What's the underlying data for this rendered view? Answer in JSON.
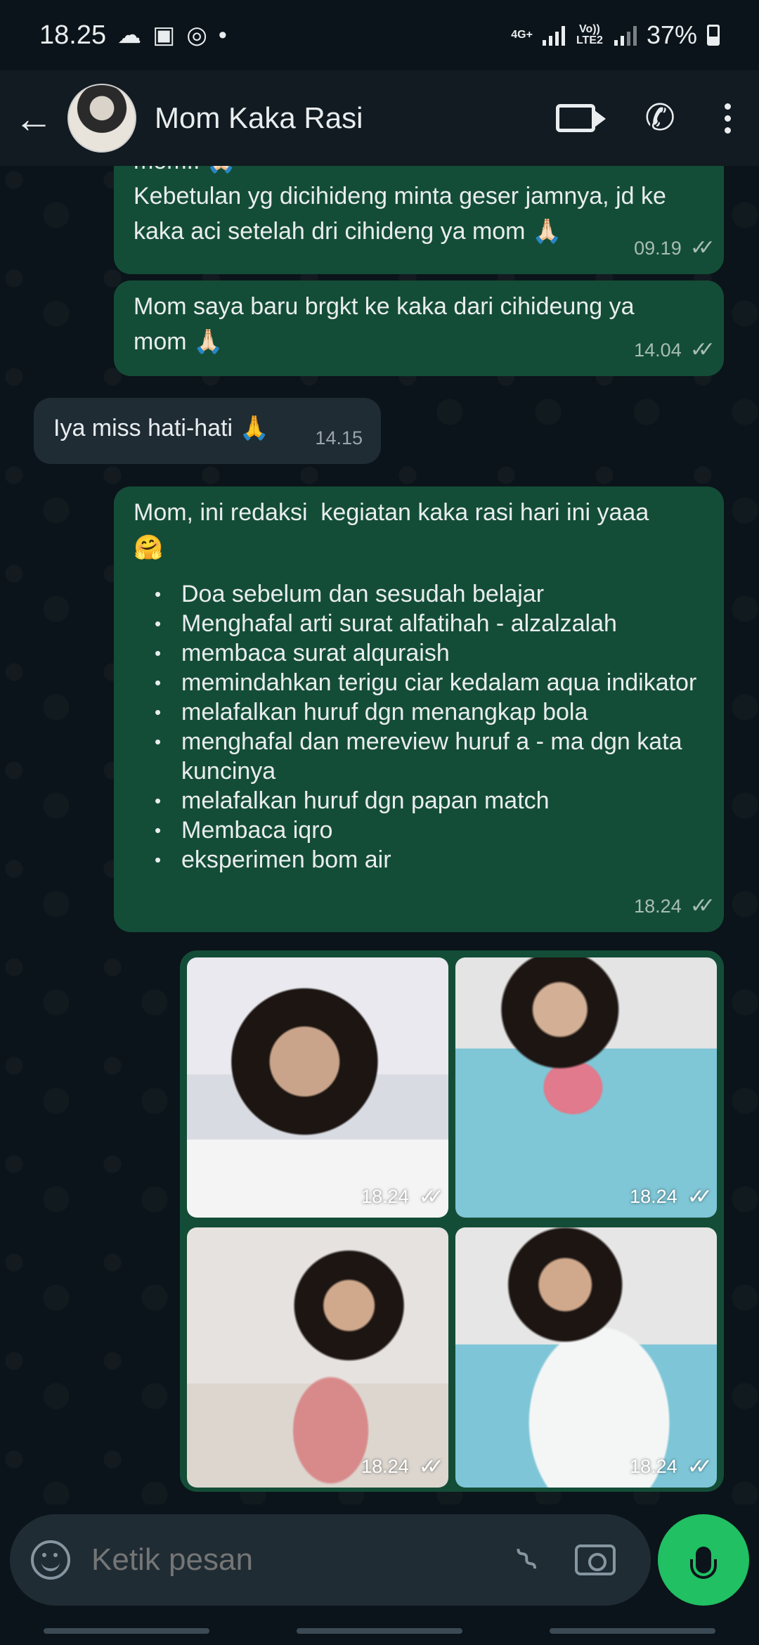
{
  "status_bar": {
    "time": "18.25",
    "network_4g": "4G+",
    "network_lte": "Vo)) LTE2",
    "battery": "37%"
  },
  "header": {
    "contact_name": "Mom Kaka Rasi"
  },
  "messages": [
    {
      "id": "m1",
      "direction": "outgoing",
      "text": "mom.. 🙏🏻\nKebetulan yg dicihideng minta geser jamnya, jd ke kaka aci setelah dri cihideng ya mom 🙏🏻",
      "time": "09.19",
      "read": true
    },
    {
      "id": "m2",
      "direction": "outgoing",
      "text": "Mom saya baru brgkt ke kaka dari cihideung ya mom 🙏🏻",
      "time": "14.04",
      "read": true
    },
    {
      "id": "m3",
      "direction": "incoming",
      "text": "Iya miss hati-hati 🙏",
      "time": "14.15"
    },
    {
      "id": "m4",
      "direction": "outgoing",
      "intro": "Mom, ini redaksi  kegiatan kaka rasi hari ini yaaa\n🤗",
      "activities": [
        "Doa sebelum dan sesudah belajar",
        "Menghafal arti surat alfatihah - alzalzalah",
        "membaca surat alquraish",
        "memindahkan terigu ciar kedalam aqua indikator",
        "melafalkan huruf dgn menangkap bola",
        " menghafal dan mereview huruf a - ma dgn kata kuncinya",
        "melafalkan huruf dgn papan match",
        "Membaca iqro",
        "eksperimen bom air"
      ],
      "time": "18.24",
      "read": true
    }
  ],
  "media": [
    {
      "time": "18.24"
    },
    {
      "time": "18.24"
    },
    {
      "time": "18.24"
    },
    {
      "time": "18.24"
    }
  ],
  "input": {
    "placeholder": "Ketik pesan"
  },
  "icons": {
    "back": "back-arrow-icon",
    "video": "video-call-icon",
    "phone": "phone-icon",
    "more": "more-options-icon",
    "emoji": "emoji-icon",
    "attach": "paperclip-icon",
    "camera": "camera-icon",
    "mic": "mic-icon"
  },
  "colors": {
    "outgoing_bubble": "#144d37",
    "incoming_bubble": "#1f2c34",
    "background": "#0b141a",
    "header": "#111b21",
    "mic_button": "#21c063"
  }
}
